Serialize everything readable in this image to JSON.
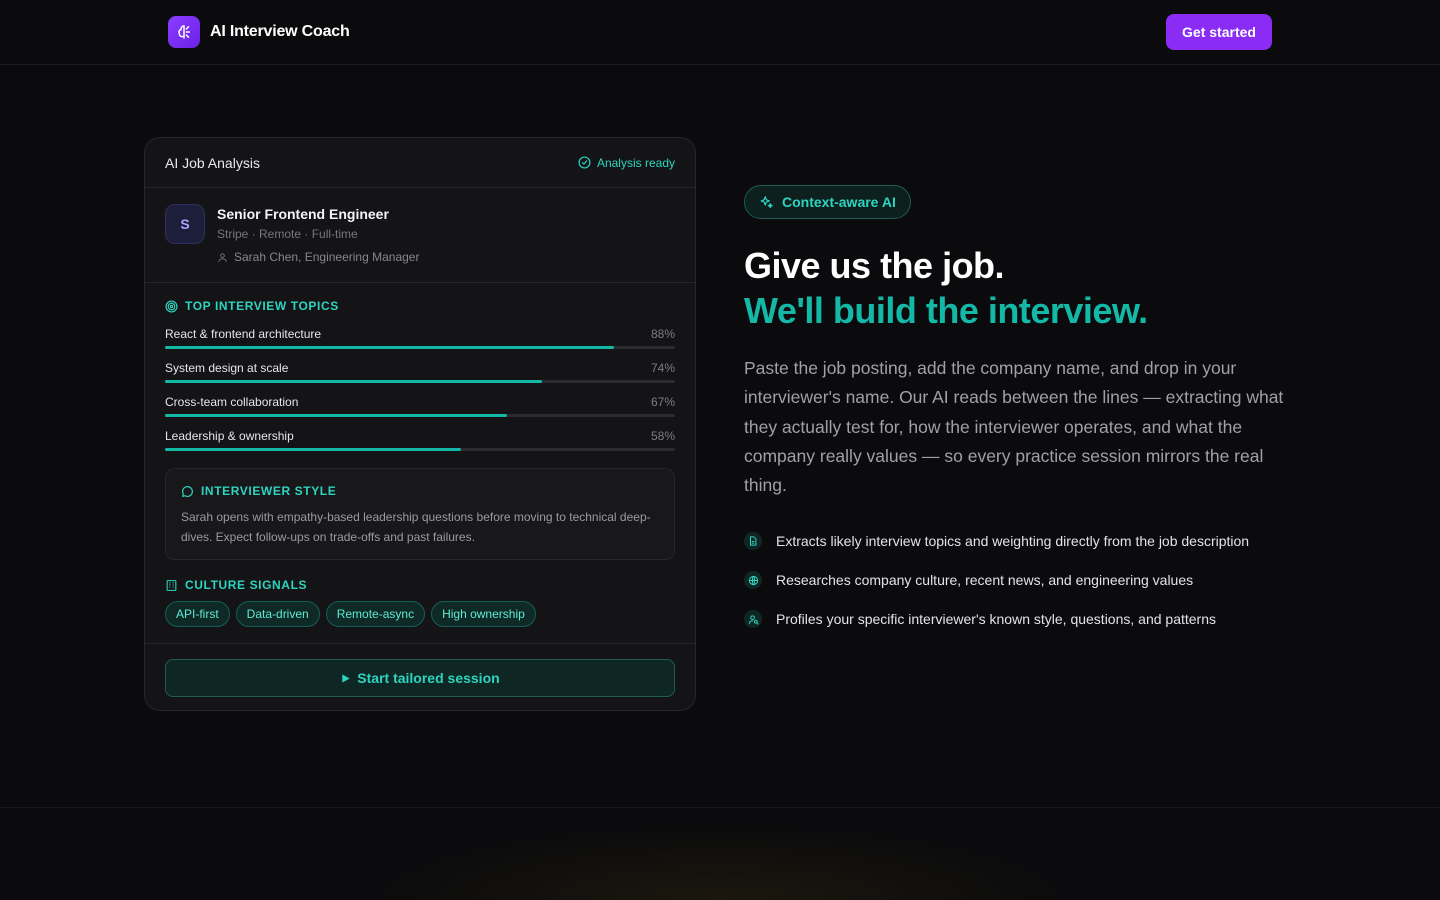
{
  "header": {
    "brand_name": "AI Interview Coach",
    "cta_label": "Get started"
  },
  "card": {
    "title": "AI Job Analysis",
    "status": "Analysis ready",
    "job": {
      "avatar_letter": "S",
      "title": "Senior Frontend Engineer",
      "meta": "Stripe · Remote · Full-time",
      "interviewer": "Sarah Chen, Engineering Manager"
    },
    "topics_label": "TOP INTERVIEW TOPICS",
    "topics": [
      {
        "name": "React & frontend architecture",
        "percent_label": "88%",
        "value": 88
      },
      {
        "name": "System design at scale",
        "percent_label": "74%",
        "value": 74
      },
      {
        "name": "Cross-team collaboration",
        "percent_label": "67%",
        "value": 67
      },
      {
        "name": "Leadership & ownership",
        "percent_label": "58%",
        "value": 58
      }
    ],
    "style_label": "INTERVIEWER STYLE",
    "style_text": "Sarah opens with empathy-based leadership questions before moving to technical deep-dives. Expect follow-ups on trade-offs and past failures.",
    "culture_label": "CULTURE SIGNALS",
    "culture_tags": [
      "API-first",
      "Data-driven",
      "Remote-async",
      "High ownership"
    ],
    "start_label": "Start tailored session"
  },
  "hero": {
    "badge": "Context-aware AI",
    "headline_1": "Give us the job.",
    "headline_2": "We'll build the interview.",
    "lead": "Paste the job posting, add the company name, and drop in your interviewer's name. Our AI reads between the lines — extracting what they actually test for, how the interviewer operates, and what the company really values — so every practice session mirrors the real thing.",
    "features": [
      {
        "icon": "document-icon",
        "text": "Extracts likely interview topics and weighting directly from the job description"
      },
      {
        "icon": "globe-icon",
        "text": "Researches company culture, recent news, and engineering values"
      },
      {
        "icon": "user-search-icon",
        "text": "Profiles your specific interviewer's known style, questions, and patterns"
      }
    ]
  },
  "colors": {
    "accent_teal": "#14b8a6",
    "accent_purple": "#8b2cf5",
    "background": "#0b0b0d"
  }
}
